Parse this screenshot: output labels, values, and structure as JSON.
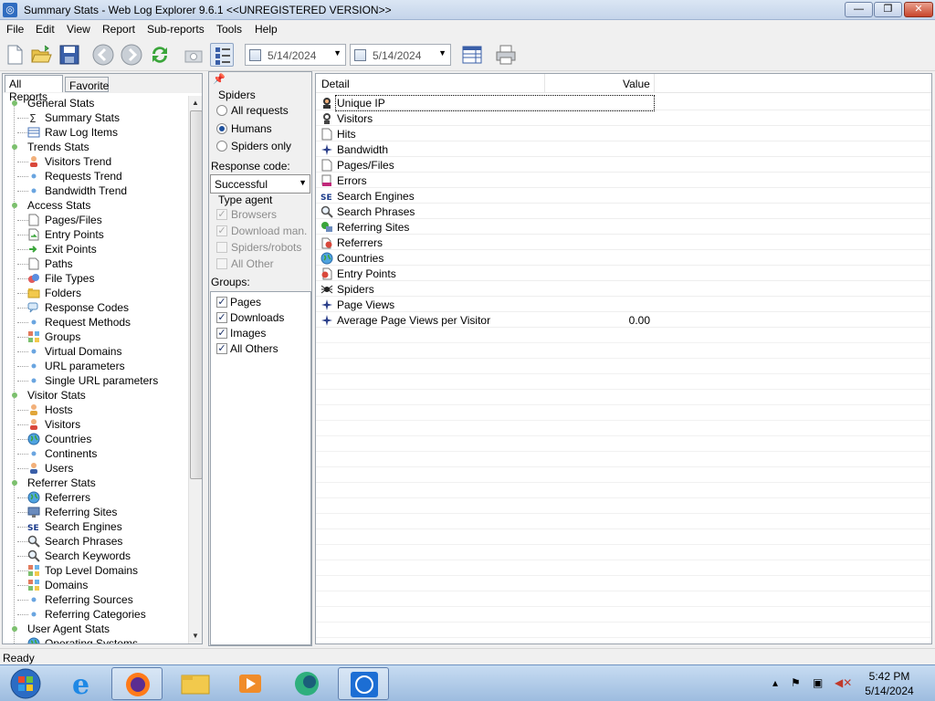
{
  "window": {
    "title": "Summary Stats - Web Log Explorer 9.6.1 <<UNREGISTERED VERSION>>",
    "min": "—",
    "max": "❐",
    "close": "✕"
  },
  "menu": [
    "File",
    "Edit",
    "View",
    "Report",
    "Sub-reports",
    "Tools",
    "Help"
  ],
  "toolbar": {
    "date_from": "5/14/2024",
    "date_to": "5/14/2024"
  },
  "left": {
    "tabs": [
      "All Reports",
      "Favorite"
    ],
    "tree": [
      {
        "label": "General Stats",
        "level": 0
      },
      {
        "label": "Summary Stats",
        "level": 1,
        "icon": "sigma-icon"
      },
      {
        "label": "Raw Log Items",
        "level": 1,
        "icon": "table-icon"
      },
      {
        "label": "Trends Stats",
        "level": 0
      },
      {
        "label": "Visitors Trend",
        "level": 1,
        "icon": "person-icon"
      },
      {
        "label": "Requests Trend",
        "level": 1,
        "icon": "dot-icon"
      },
      {
        "label": "Bandwidth Trend",
        "level": 1,
        "icon": "dot-icon"
      },
      {
        "label": "Access Stats",
        "level": 0
      },
      {
        "label": "Pages/Files",
        "level": 1,
        "icon": "page-icon"
      },
      {
        "label": "Entry Points",
        "level": 1,
        "icon": "enter-icon"
      },
      {
        "label": "Exit Points",
        "level": 1,
        "icon": "exit-icon"
      },
      {
        "label": "Paths",
        "level": 1,
        "icon": "page-icon"
      },
      {
        "label": "File Types",
        "level": 1,
        "icon": "filetypes-icon"
      },
      {
        "label": "Folders",
        "level": 1,
        "icon": "folder-icon"
      },
      {
        "label": "Response Codes",
        "level": 1,
        "icon": "chat-icon"
      },
      {
        "label": "Request Methods",
        "level": 1,
        "icon": "dot-icon"
      },
      {
        "label": "Groups",
        "level": 1,
        "icon": "grid-icon"
      },
      {
        "label": "Virtual Domains",
        "level": 1,
        "icon": "dot-icon"
      },
      {
        "label": "URL parameters",
        "level": 1,
        "icon": "dot-icon"
      },
      {
        "label": "Single URL parameters",
        "level": 1,
        "icon": "dot-icon"
      },
      {
        "label": "Visitor Stats",
        "level": 0
      },
      {
        "label": "Hosts",
        "level": 1,
        "icon": "hosts-icon"
      },
      {
        "label": "Visitors",
        "level": 1,
        "icon": "person-icon"
      },
      {
        "label": "Countries",
        "level": 1,
        "icon": "globe-icon"
      },
      {
        "label": "Continents",
        "level": 1,
        "icon": "dot-icon"
      },
      {
        "label": "Users",
        "level": 1,
        "icon": "user-icon"
      },
      {
        "label": "Referrer Stats",
        "level": 0
      },
      {
        "label": "Referrers",
        "level": 1,
        "icon": "globe-icon"
      },
      {
        "label": "Referring Sites",
        "level": 1,
        "icon": "monitor-icon"
      },
      {
        "label": "Search Engines",
        "level": 1,
        "icon": "se-icon"
      },
      {
        "label": "Search Phrases",
        "level": 1,
        "icon": "magnifier-icon"
      },
      {
        "label": "Search Keywords",
        "level": 1,
        "icon": "magnifier-icon"
      },
      {
        "label": "Top Level Domains",
        "level": 1,
        "icon": "grid-icon"
      },
      {
        "label": "Domains",
        "level": 1,
        "icon": "grid-icon"
      },
      {
        "label": "Referring Sources",
        "level": 1,
        "icon": "dot-icon"
      },
      {
        "label": "Referring Categories",
        "level": 1,
        "icon": "dot-icon"
      },
      {
        "label": "User Agent Stats",
        "level": 0
      },
      {
        "label": "Operating Systems",
        "level": 1,
        "icon": "globe-icon"
      }
    ]
  },
  "filters": {
    "spiders_label": "Spiders",
    "spiders_options": [
      "All requests",
      "Humans",
      "Spiders only"
    ],
    "spiders_selected": 1,
    "response_label": "Response code:",
    "response_value": "Successful",
    "type_agent_label": "Type agent",
    "type_agent_options": [
      "Browsers",
      "Download man.",
      "Spiders/robots",
      "All Other"
    ],
    "type_agent_checked": [
      true,
      true,
      false,
      false
    ],
    "groups_label": "Groups:",
    "groups": [
      "Pages",
      "Downloads",
      "Images",
      "All Others"
    ]
  },
  "main": {
    "columns": [
      "Detail",
      "Value"
    ],
    "rows": [
      {
        "label": "Unique IP",
        "value": "",
        "icon": "unique-ip-icon"
      },
      {
        "label": "Visitors",
        "value": "",
        "icon": "visitor-icon"
      },
      {
        "label": "Hits",
        "value": "",
        "icon": "page-icon"
      },
      {
        "label": "Bandwidth",
        "value": "",
        "icon": "star-icon"
      },
      {
        "label": "Pages/Files",
        "value": "",
        "icon": "page-icon"
      },
      {
        "label": "Errors",
        "value": "",
        "icon": "error-icon"
      },
      {
        "label": "Search Engines",
        "value": "",
        "icon": "se-icon"
      },
      {
        "label": "Search Phrases",
        "value": "",
        "icon": "magnifier-icon"
      },
      {
        "label": "Referring Sites",
        "value": "",
        "icon": "referring-sites-icon"
      },
      {
        "label": "Referrers",
        "value": "",
        "icon": "referrers-icon"
      },
      {
        "label": "Countries",
        "value": "",
        "icon": "globe-icon"
      },
      {
        "label": "Entry Points",
        "value": "",
        "icon": "entry-icon"
      },
      {
        "label": "Spiders",
        "value": "",
        "icon": "spider-icon"
      },
      {
        "label": "Page Views",
        "value": "",
        "icon": "star-icon"
      },
      {
        "label": "Average Page Views per Visitor",
        "value": "0.00",
        "icon": "star-icon"
      }
    ]
  },
  "status": {
    "text": "Ready"
  },
  "taskbar": {
    "time": "5:42 PM",
    "date": "5/14/2024"
  },
  "colors": {
    "accent": "#2f6cc0",
    "tree_dot": "#7cc06e",
    "sub_dot": "#6aa5e0"
  }
}
